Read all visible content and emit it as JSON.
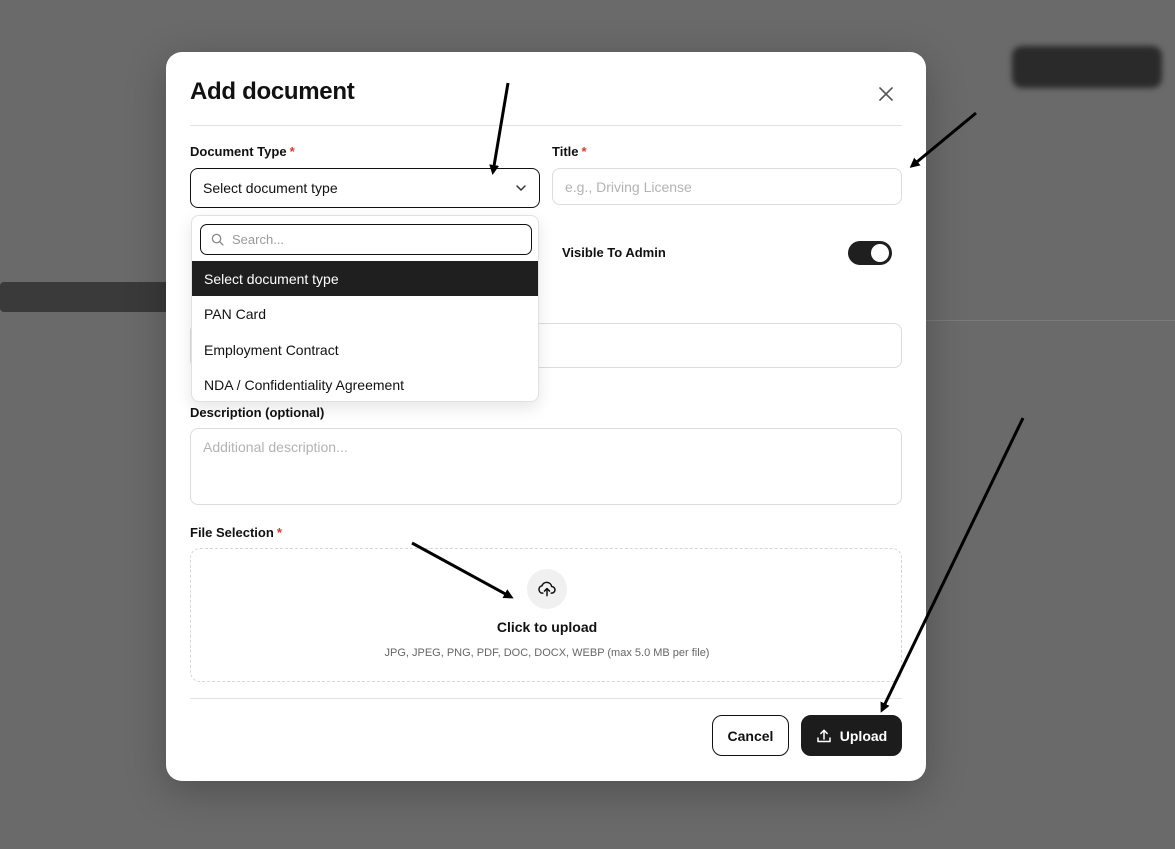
{
  "modal": {
    "title": "Add document",
    "close_icon": "close-icon"
  },
  "fields": {
    "document_type": {
      "label": "Document Type",
      "required_mark": "*",
      "selected": "Select document type"
    },
    "title": {
      "label": "Title",
      "required_mark": "*",
      "placeholder": "e.g., Driving License"
    },
    "visible_to_admin": {
      "label": "Visible To Admin",
      "on": true
    },
    "description": {
      "label": "Description (optional)",
      "placeholder": "Additional description..."
    },
    "file_selection": {
      "label": "File Selection",
      "required_mark": "*",
      "upload_title": "Click to upload",
      "upload_hint": "JPG, JPEG, PNG, PDF, DOC, DOCX, WEBP (max 5.0 MB per file)",
      "icon": "cloud-upload-icon"
    }
  },
  "dropdown": {
    "search_placeholder": "Search...",
    "options": [
      "Select document type",
      "PAN Card",
      "Employment Contract",
      "NDA / Confidentiality Agreement"
    ],
    "active_index": 0
  },
  "footer": {
    "cancel_label": "Cancel",
    "upload_label": "Upload",
    "upload_icon": "upload-icon"
  },
  "colors": {
    "overlay": "#6b6b6b",
    "primary": "#1c1c1c",
    "required": "#e0362c"
  }
}
